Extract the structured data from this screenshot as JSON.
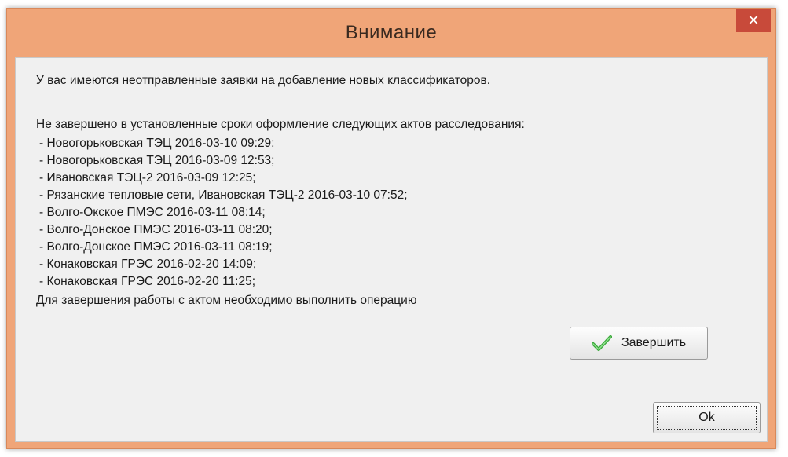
{
  "dialog": {
    "title": "Внимание",
    "close_glyph": "✕",
    "message_1": "У вас имеются неотправленные заявки на добавление новых классификаторов.",
    "message_2": "Не завершено в установленные сроки оформление следующих актов расследования:",
    "acts": [
      "- Новогорьковская ТЭЦ 2016-03-10 09:29;",
      "- Новогорьковская ТЭЦ 2016-03-09 12:53;",
      "- Ивановская ТЭЦ-2 2016-03-09 12:25;",
      "- Рязанские тепловые сети, Ивановская ТЭЦ-2 2016-03-10 07:52;",
      "- Волго-Окское ПМЭС 2016-03-11 08:14;",
      "- Волго-Донское ПМЭС 2016-03-11 08:20;",
      "- Волго-Донское ПМЭС 2016-03-11 08:19;",
      "- Конаковская ГРЭС 2016-02-20 14:09;",
      "- Конаковская ГРЭС 2016-02-20 11:25;"
    ],
    "message_3": "Для завершения работы с актом необходимо выполнить операцию",
    "finish_button": "Завершить",
    "finish_icon": "check-icon",
    "ok_button": "Ok"
  },
  "colors": {
    "frame": "#f0a578",
    "close": "#c84a3a",
    "check": "#3aa83a"
  }
}
